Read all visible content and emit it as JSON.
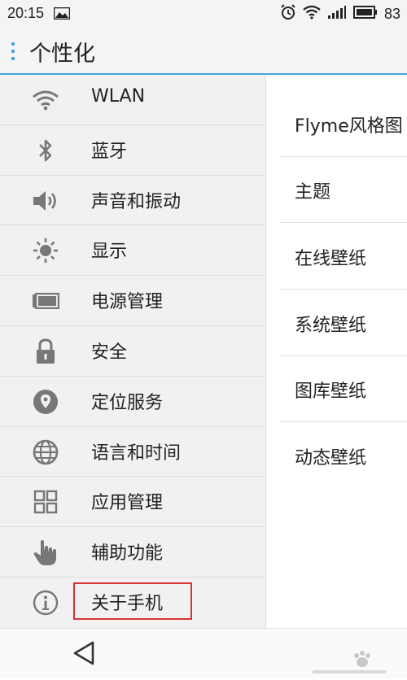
{
  "status_bar": {
    "time": "20:15",
    "battery_level": "83"
  },
  "title_bar": {
    "title": "个性化"
  },
  "left_menu": {
    "items": [
      {
        "label": "WLAN",
        "icon": "wifi-icon"
      },
      {
        "label": "蓝牙",
        "icon": "bluetooth-icon"
      },
      {
        "label": "声音和振动",
        "icon": "speaker-icon"
      },
      {
        "label": "显示",
        "icon": "brightness-icon"
      },
      {
        "label": "电源管理",
        "icon": "battery-icon"
      },
      {
        "label": "安全",
        "icon": "lock-icon"
      },
      {
        "label": "定位服务",
        "icon": "location-pin-icon"
      },
      {
        "label": "语言和时间",
        "icon": "globe-icon"
      },
      {
        "label": "应用管理",
        "icon": "grid-icon"
      },
      {
        "label": "辅助功能",
        "icon": "hand-pointer-icon"
      },
      {
        "label": "关于手机",
        "icon": "info-icon"
      }
    ],
    "highlighted_item": "关于手机",
    "highlight_color": "#d93236"
  },
  "right_menu": {
    "items": [
      {
        "label": "Flyme风格图"
      },
      {
        "label": "主题"
      },
      {
        "label": "在线壁纸"
      },
      {
        "label": "系统壁纸"
      },
      {
        "label": "图库壁纸"
      },
      {
        "label": "动态壁纸"
      }
    ]
  },
  "colors": {
    "accent": "#4aa6d9",
    "highlight": "#d93236",
    "icon_gray": "#6e6e6e"
  }
}
